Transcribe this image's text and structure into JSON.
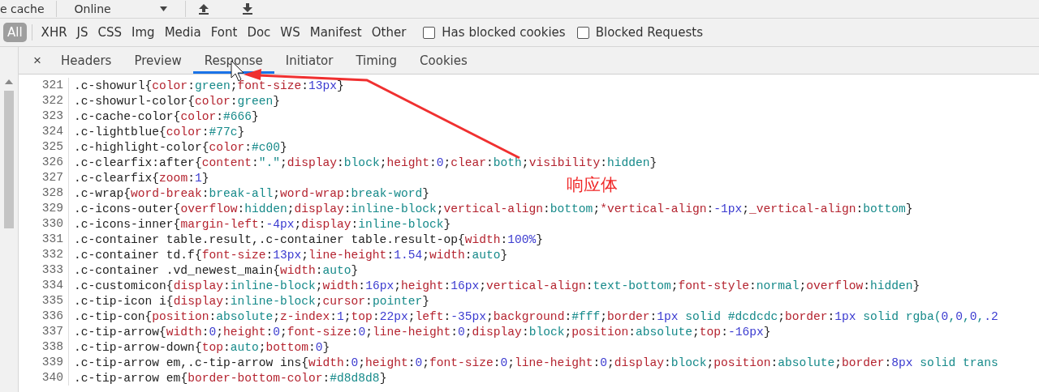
{
  "toolbar": {
    "cache_label": "e cache",
    "throttle": "Online"
  },
  "filters": {
    "types": [
      {
        "label": "All",
        "selected": true
      },
      {
        "label": "XHR",
        "selected": false
      },
      {
        "label": "JS",
        "selected": false
      },
      {
        "label": "CSS",
        "selected": false
      },
      {
        "label": "Img",
        "selected": false
      },
      {
        "label": "Media",
        "selected": false
      },
      {
        "label": "Font",
        "selected": false
      },
      {
        "label": "Doc",
        "selected": false
      },
      {
        "label": "WS",
        "selected": false
      },
      {
        "label": "Manifest",
        "selected": false
      },
      {
        "label": "Other",
        "selected": false
      }
    ],
    "checkboxes": [
      {
        "label": "Has blocked cookies",
        "checked": false
      },
      {
        "label": "Blocked Requests",
        "checked": false
      }
    ]
  },
  "tabs": {
    "close": "×",
    "items": [
      {
        "label": "Headers",
        "selected": false
      },
      {
        "label": "Preview",
        "selected": false
      },
      {
        "label": "Response",
        "selected": true
      },
      {
        "label": "Initiator",
        "selected": false
      },
      {
        "label": "Timing",
        "selected": false
      },
      {
        "label": "Cookies",
        "selected": false
      }
    ]
  },
  "code_lines": [
    {
      "number": "321",
      "text": ".c-showurl{color:green;font-size:13px}"
    },
    {
      "number": "322",
      "text": ".c-showurl-color{color:green}"
    },
    {
      "number": "323",
      "text": ".c-cache-color{color:#666}"
    },
    {
      "number": "324",
      "text": ".c-lightblue{color:#77c}"
    },
    {
      "number": "325",
      "text": ".c-highlight-color{color:#c00}"
    },
    {
      "number": "326",
      "text": ".c-clearfix:after{content:\".\";display:block;height:0;clear:both;visibility:hidden}"
    },
    {
      "number": "327",
      "text": ".c-clearfix{zoom:1}"
    },
    {
      "number": "328",
      "text": ".c-wrap{word-break:break-all;word-wrap:break-word}"
    },
    {
      "number": "329",
      "text": ".c-icons-outer{overflow:hidden;display:inline-block;vertical-align:bottom;*vertical-align:-1px;_vertical-align:bottom}"
    },
    {
      "number": "330",
      "text": ".c-icons-inner{margin-left:-4px;display:inline-block}"
    },
    {
      "number": "331",
      "text": ".c-container table.result,.c-container table.result-op{width:100%}"
    },
    {
      "number": "332",
      "text": ".c-container td.f{font-size:13px;line-height:1.54;width:auto}"
    },
    {
      "number": "333",
      "text": ".c-container .vd_newest_main{width:auto}"
    },
    {
      "number": "334",
      "text": ".c-customicon{display:inline-block;width:16px;height:16px;vertical-align:text-bottom;font-style:normal;overflow:hidden}"
    },
    {
      "number": "335",
      "text": ".c-tip-icon i{display:inline-block;cursor:pointer}"
    },
    {
      "number": "336",
      "text": ".c-tip-con{position:absolute;z-index:1;top:22px;left:-35px;background:#fff;border:1px solid #dcdcdc;border:1px solid rgba(0,0,0,.2"
    },
    {
      "number": "337",
      "text": ".c-tip-arrow{width:0;height:0;font-size:0;line-height:0;display:block;position:absolute;top:-16px}"
    },
    {
      "number": "338",
      "text": ".c-tip-arrow-down{top:auto;bottom:0}"
    },
    {
      "number": "339",
      "text": ".c-tip-arrow em,.c-tip-arrow ins{width:0;height:0;font-size:0;line-height:0;display:block;position:absolute;border:8px solid trans"
    },
    {
      "number": "340",
      "text": ".c-tip-arrow em{border-bottom-color:#d8d8d8}"
    }
  ],
  "annotation": {
    "label": "响应体"
  }
}
